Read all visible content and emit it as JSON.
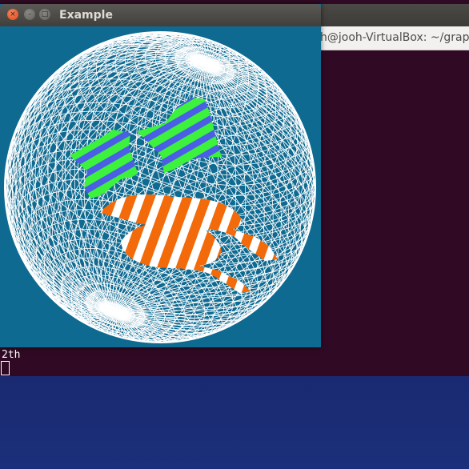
{
  "window": {
    "title": "Example",
    "buttons": {
      "close": "×",
      "minimize": "–",
      "maximize": "□"
    }
  },
  "terminal": {
    "title": "h@jooh-VirtualBox: ~/grap",
    "output": "2th"
  },
  "scene": {
    "background": "#0e6a91",
    "wireframe_color": "#ffffff",
    "object_colors": {
      "green_object": "#3cf23c",
      "blue_stripe": "#4a5ee6",
      "orange_object": "#f26a0a",
      "white_stripe": "#ffffff"
    }
  }
}
